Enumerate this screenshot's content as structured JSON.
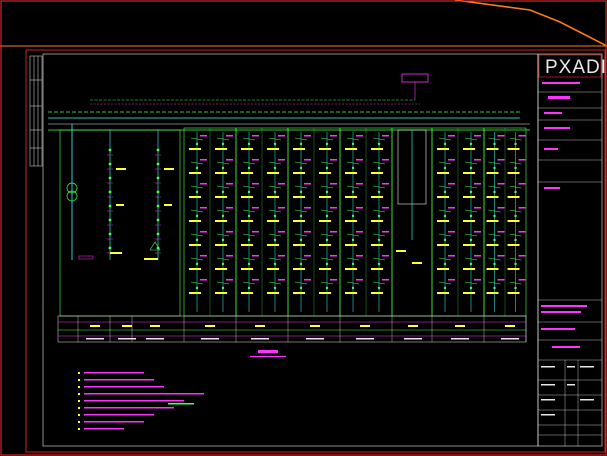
{
  "title_block": {
    "logo": "PXADI",
    "logo_sub": "",
    "fields": [
      "",
      "",
      "",
      "",
      "",
      "",
      "",
      ""
    ]
  },
  "colors": {
    "background": "#000000",
    "frame": "#ff2a2a",
    "magenta": "#ff33ff",
    "green": "#4cff4c",
    "yellow": "#ffff33",
    "cyan": "#33ffff",
    "white": "#e8e8e8",
    "orange": "#ff7a1a"
  },
  "icons": [
    "transformer-symbol",
    "breaker-symbol",
    "ground-symbol"
  ],
  "diagram": {
    "panel_count": 14,
    "legend_lines": 9
  }
}
